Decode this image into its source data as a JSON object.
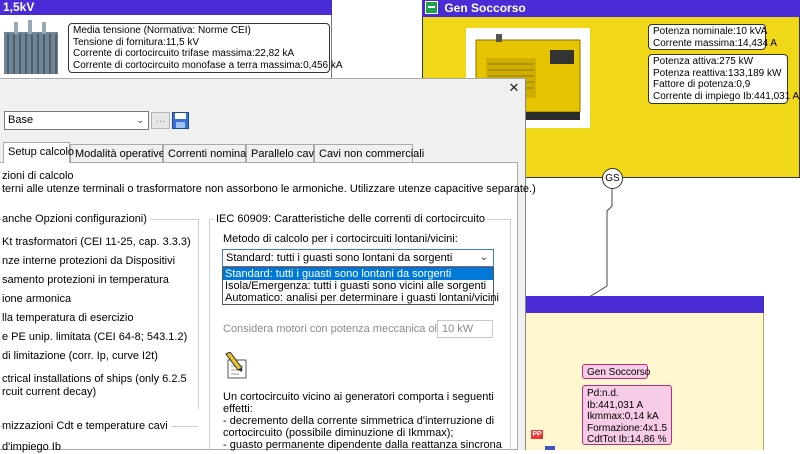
{
  "left_panel": {
    "header_title": "1,5kV",
    "transformer_info": [
      "Media tensione (Normativa: Norme CEI)",
      "Tensione di fornitura:11,5 kV",
      "Corrente di cortocircuito trifase massima:22,82 kA",
      "Corrente di cortocircuito monofase a terra massima:0,456 kA"
    ]
  },
  "gen_panel": {
    "header_title": "Gen Soccorso",
    "rating_info": [
      "Potenza nominale:10 kVA",
      "Corrente massima:14,434 A"
    ],
    "power_info": [
      "Potenza attiva:275 kW",
      "Potenza reattiva:133,189 kW",
      "Fattore di potenza:0,9",
      "Corrente di impiego Ib:441,031 A"
    ],
    "gs_symbol": "GS",
    "colors": {
      "yellow": "#f0d818",
      "header": "#4a2bd6"
    }
  },
  "lower_panel": {
    "node_label": "Gen Soccorso",
    "details": [
      "Pd:n.d.",
      "Ib:441,031 A",
      "Ikmmax:0,14 kA",
      "Formazione:4x1.5",
      "CdtTot Ib:14,86 %"
    ],
    "pp_badge": "PP"
  },
  "dialog": {
    "close_glyph": "✕",
    "profile_value": "Base",
    "ellipsis_label": "...",
    "tabs": [
      "Setup calcolo",
      "Modalità operative",
      "Correnti nominali",
      "Parallelo cavi",
      "Cavi non commerciali"
    ],
    "options_title": "zioni di calcolo",
    "options_note": "terni alle utenze terminali o trasformatore non assorbono le armoniche. Utilizzare utenze capacitive separate.)",
    "left_group_title": "anche Opzioni configurazioni)",
    "left_options": [
      "Kt trasformatori (CEI 11-25, cap. 3.3.3)",
      "nze interne protezioni da Dispositivi",
      "samento protezioni in temperatura",
      "ione armonica",
      "lla temperatura di esercizio",
      "e PE unip. limitata (CEI 64-8; 543.1.2)",
      "di limitazione (corr. Ip, curve I2t)",
      "ctrical installations of ships (only 6.2.5",
      "rcuit current decay)"
    ],
    "bottom_group_title": "mizzazioni Cdt e temperature cavi",
    "bottom_cut_text": "d'impiego Ib",
    "iec_title": "IEC 60909: Caratteristiche delle correnti di cortocircuito",
    "method_label": "Metodo di calcolo per i cortocircuiti lontani/vicini:",
    "method_selected": "Standard: tutti i guasti sono lontani da sorgenti",
    "method_options": [
      "Standard: tutti i guasti sono lontani da sorgenti",
      "Isola/Emergenza: tutti i guasti sono vicini alle sorgenti",
      "Automatico: analisi per determinare i guasti lontani/vicini"
    ],
    "motors_label": "Considera motori con potenza meccanica oltre:",
    "motors_value": "10 kW",
    "note_lines": [
      "Un cortocircuito vicino ai generatori comporta i seguenti",
      "effetti:",
      "- decremento della corrente simmetrica d'interruzione di",
      "cortocircuito (possibile diminuzione di Ikmmax);",
      "- guasto permanente dipendente dalla reattanza sincrona"
    ]
  }
}
